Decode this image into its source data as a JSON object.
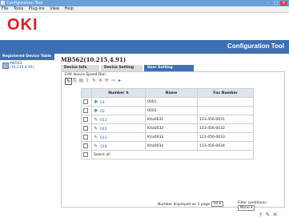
{
  "window": {
    "title": "Configuration Tool",
    "minimize": "–",
    "maximize": "□",
    "close": "×"
  },
  "menu": [
    "File",
    "Tools",
    "Plug-ins",
    "View",
    "Help"
  ],
  "brand": {
    "logo": "OKI",
    "app_title": "Configuration Tool",
    "logo_color": "#e01c24",
    "accent": "#3e6fb4"
  },
  "sidebar": {
    "header": "Registered Device Table",
    "items": [
      {
        "label": "MB562",
        "sub": "(10.215.4.91)"
      }
    ]
  },
  "device": {
    "title": "MB562(10.215.4.91)"
  },
  "tabs": [
    "Device Info",
    "Device Setting",
    "User Setting"
  ],
  "panel": {
    "subtitle": "Edit device Speed Dial.",
    "toolbar_icons": [
      "edit-icon",
      "copy-icon",
      "import-icon",
      "export-icon",
      "add-icon",
      "delete-icon",
      "refresh-icon",
      "forward-icon",
      "next-icon"
    ],
    "columns": [
      "Number",
      "Name",
      "Fax Number"
    ],
    "rows": [
      {
        "number": "01",
        "name": "0001",
        "fax": ""
      },
      {
        "number": "02",
        "name": "0002",
        "fax": ""
      },
      {
        "number": "011",
        "name": "Kita0031",
        "fax": "123-456-0031"
      },
      {
        "number": "012",
        "name": "Kita0032",
        "fax": "123-456-0032"
      },
      {
        "number": "013",
        "name": "Kita0033",
        "fax": "123-456-0033"
      },
      {
        "number": "014",
        "name": "Kita0034",
        "fax": "123-456-0034"
      }
    ],
    "select_all": "Select all",
    "per_page_label": "Number displayed on 1 page",
    "per_page_value": "50",
    "filter_label": "Filter conditions",
    "filter_value": "None"
  }
}
